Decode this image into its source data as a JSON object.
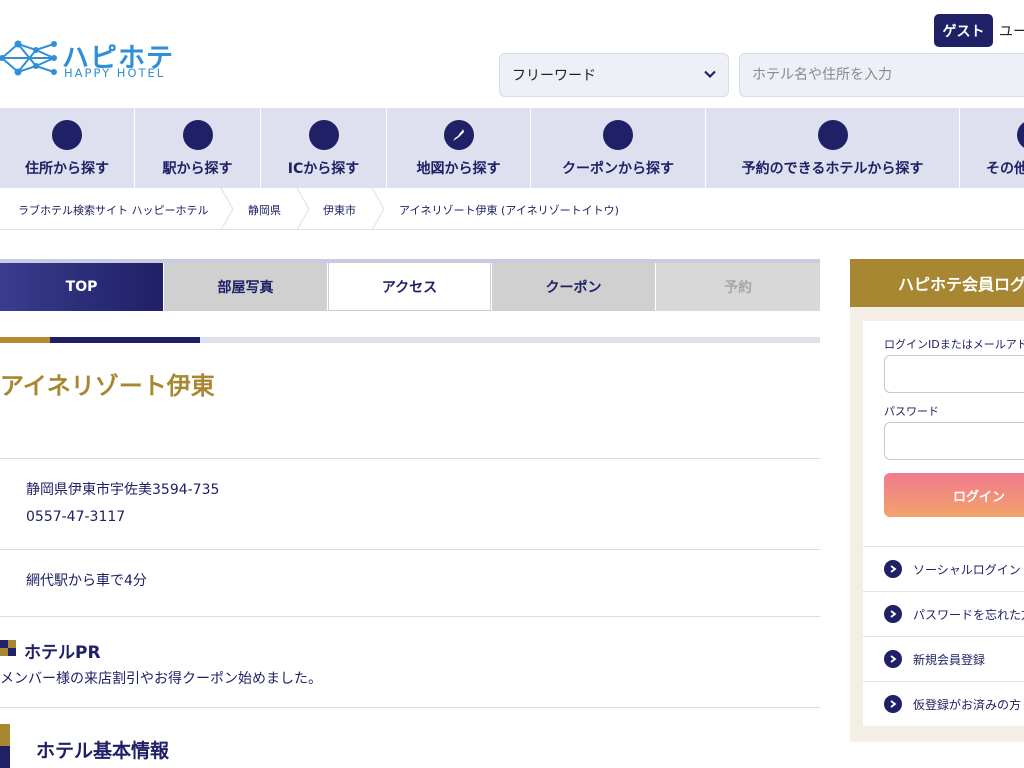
{
  "header": {
    "logo_jp": "ハピホテ",
    "logo_en": "HAPPY HOTEL",
    "guest_badge": "ゲスト",
    "user_text": "ユー",
    "search_type": "フリーワード",
    "search_placeholder": "ホテル名や住所を入力"
  },
  "category_nav": [
    {
      "label": "住所から探す"
    },
    {
      "label": "駅から探す"
    },
    {
      "label": "ICから探す"
    },
    {
      "label": "地図から探す"
    },
    {
      "label": "クーポンから探す"
    },
    {
      "label": "予約のできるホテルから探す"
    },
    {
      "label": "その他"
    }
  ],
  "breadcrumb": [
    "ラブホテル検索サイト ハッピーホテル",
    "静岡県",
    "伊東市",
    "アイネリゾート伊東 (アイネリゾートイトウ)"
  ],
  "tabs": {
    "top": "TOP",
    "photo": "部屋写真",
    "access": "アクセス",
    "coupon": "クーポン",
    "reserve": "予約"
  },
  "hotel": {
    "name": "アイネリゾート伊東",
    "address": "静岡県伊東市宇佐美3594-735",
    "phone": "0557-47-3117",
    "access": "網代駅から車で4分",
    "pr_title": "ホテルPR",
    "pr_text": "メンバー様の来店割引やお得クーポン始めました。",
    "basic_info_title": "ホテル基本情報"
  },
  "login": {
    "title": "ハピホテ会員ログ",
    "id_label": "ログインIDまたはメールアドレ",
    "password_label": "パスワード",
    "login_button": "ログイン",
    "links": [
      "ソーシャルログイン",
      "パスワードを忘れた方",
      "新規会員登録",
      "仮登録がお済みの方"
    ]
  },
  "colors": {
    "navy": "#1f2066",
    "gold": "#a88732",
    "nav_bg": "#dfe0ef",
    "logo_blue": "#2f8fd8"
  }
}
